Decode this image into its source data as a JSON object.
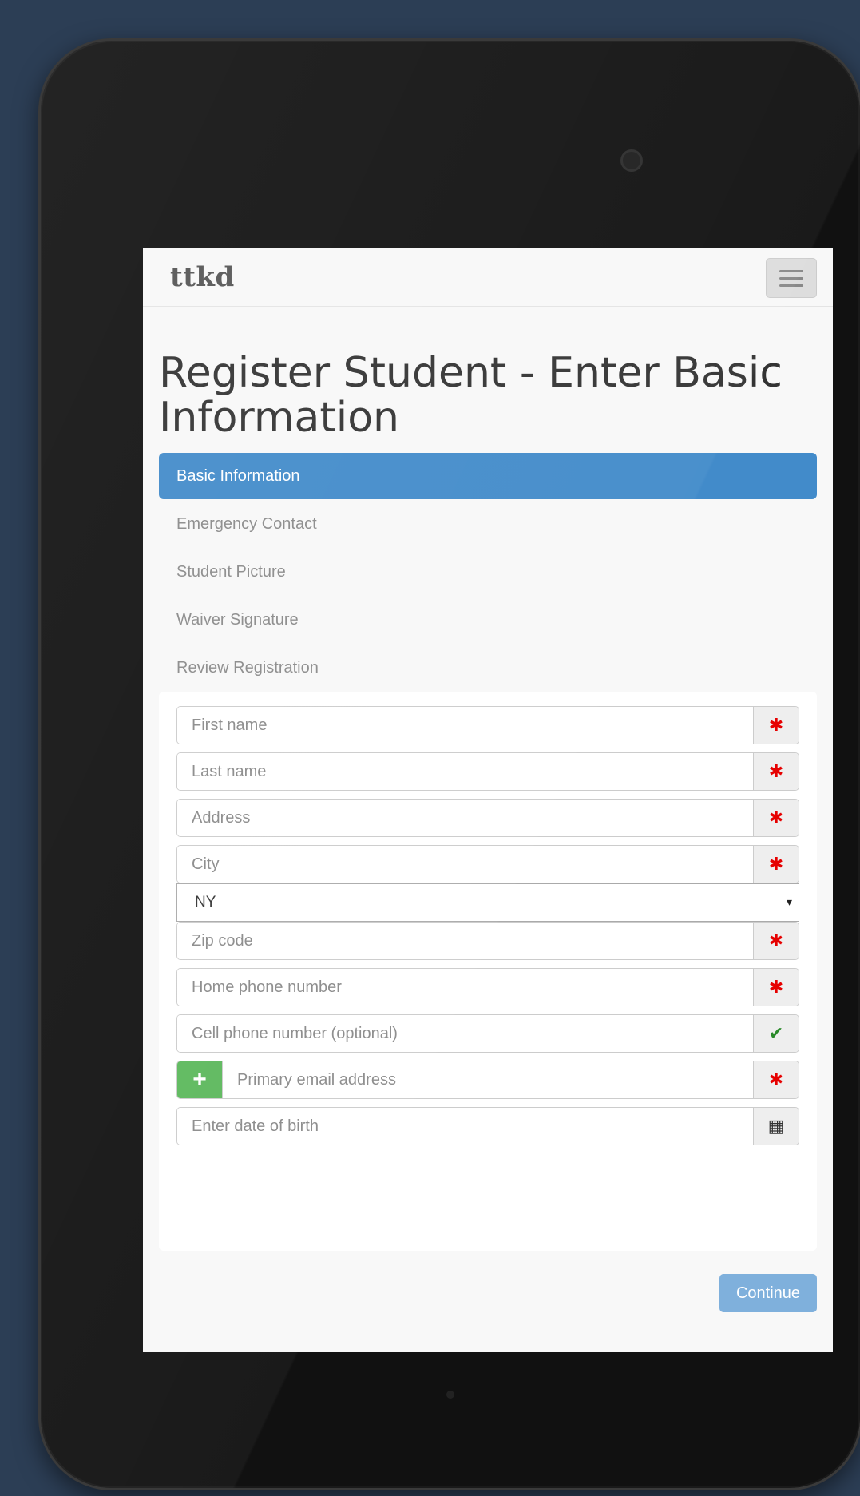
{
  "app": {
    "brand": "ttkd"
  },
  "page": {
    "title": "Register Student - Enter Basic Information"
  },
  "steps": [
    {
      "label": "Basic Information",
      "active": true
    },
    {
      "label": "Emergency Contact",
      "active": false
    },
    {
      "label": "Student Picture",
      "active": false
    },
    {
      "label": "Waiver Signature",
      "active": false
    },
    {
      "label": "Review Registration",
      "active": false
    }
  ],
  "form": {
    "first_name": {
      "placeholder": "First name",
      "addon": "✱"
    },
    "last_name": {
      "placeholder": "Last name",
      "addon": "✱"
    },
    "address": {
      "placeholder": "Address",
      "addon": "✱"
    },
    "city": {
      "placeholder": "City",
      "addon": "✱"
    },
    "state": {
      "selected": "NY",
      "caret": "▾"
    },
    "zip": {
      "placeholder": "Zip code",
      "addon": "✱"
    },
    "home_phone": {
      "placeholder": "Home phone number",
      "addon": "✱"
    },
    "cell_phone": {
      "placeholder": "Cell phone number (optional)",
      "addon": "✔"
    },
    "email": {
      "placeholder": "Primary email address",
      "add_addon": "+",
      "addon": "✱"
    },
    "dob": {
      "placeholder": "Enter date of birth",
      "addon": "▦"
    }
  },
  "actions": {
    "continue_label": "Continue"
  },
  "icons": {
    "required": "asterisk-icon",
    "valid": "check-icon",
    "add": "plus-icon",
    "calendar": "calendar-icon",
    "menu": "hamburger-icon"
  },
  "colors": {
    "accent": "#428bca",
    "success": "#5cb85c",
    "required": "#e60000",
    "background": "#2c3e55"
  }
}
